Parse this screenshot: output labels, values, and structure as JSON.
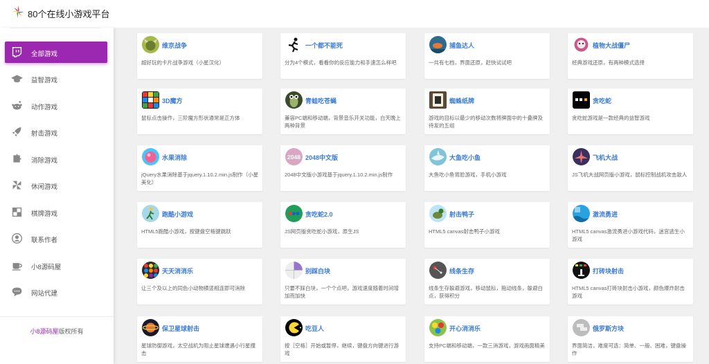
{
  "site": {
    "title": "80个在线小游戏平台"
  },
  "sidebar": {
    "items": [
      {
        "label": "全部游戏",
        "icon": "twitch-icon",
        "active": true
      },
      {
        "label": "益智游戏",
        "icon": "graduation-cap-icon"
      },
      {
        "label": "动作游戏",
        "icon": "reddit-alien-icon"
      },
      {
        "label": "射击游戏",
        "icon": "rocket-icon"
      },
      {
        "label": "消除游戏",
        "icon": "puzzle-icon"
      },
      {
        "label": "休闲游戏",
        "icon": "pinwheel-icon"
      },
      {
        "label": "棋牌游戏",
        "icon": "board-icon"
      },
      {
        "label": "联系作者",
        "icon": "user-icon"
      },
      {
        "label": "小8源码屋",
        "icon": "coffee-icon"
      },
      {
        "label": "网站代建",
        "icon": "chat-icon"
      }
    ],
    "footer": {
      "brand": "小8源码屋",
      "suffix": "版权所有"
    }
  },
  "games": [
    {
      "title": "维京战争",
      "desc": "超好玩的卡片战争游戏（小星汉化）",
      "icon": "viking-icon"
    },
    {
      "title": "一个都不能死",
      "desc": "分为4个模式，看看你的反应能力和手速怎么样吧",
      "icon": "runner-icon"
    },
    {
      "title": "捕鱼达人",
      "desc": "一共有七档，界面还原，赶快试试吧",
      "icon": "fishing-icon"
    },
    {
      "title": "植物大战僵尸",
      "desc": "经典游戏还原，有两种模式选择",
      "icon": "zombie-icon"
    },
    {
      "title": "3D魔方",
      "desc": "鼠标点击操作，三阶魔方形状通常是正方体",
      "icon": "rubiks-cube-icon"
    },
    {
      "title": "青蛙吃苍蝇",
      "desc": "兼容PC端和移动端，背景音乐开关功能，白天晚上两种背景",
      "icon": "frog-icon"
    },
    {
      "title": "蜘蛛纸牌",
      "desc": "游戏的目标以最少的移动次数将牌面中的十叠牌及待发的五组",
      "icon": "cards-icon"
    },
    {
      "title": "贪吃蛇",
      "desc": "贪吃蛇游戏是一款经典的益智游戏",
      "icon": "snake-icon"
    },
    {
      "title": "水果消除",
      "desc": "jQuery水果消除基于jquery.1.10.2.min.js制作（小星美化）",
      "icon": "fruit-icon"
    },
    {
      "title": "2048中文版",
      "desc": "2048中文版小游戏基于jquery.1.10.2.min.js制作",
      "icon": "2048-icon",
      "badge": "2048"
    },
    {
      "title": "大鱼吃小鱼",
      "desc": "大鱼吃小鱼胃脸游戏，手机小游戏",
      "icon": "shark-icon"
    },
    {
      "title": "飞机大战",
      "desc": "JS飞机大战网页版小游戏，鼠标控制战机攻击敌人",
      "icon": "plane-icon"
    },
    {
      "title": "跑酷小游戏",
      "desc": "HTML5跑酷小游戏，按键盘空格键跳跃",
      "icon": "parkour-icon"
    },
    {
      "title": "贪吃蛇2.0",
      "desc": "JS网页版贪吃蛇小游戏，原生JS",
      "icon": "snake2-icon"
    },
    {
      "title": "射击鸭子",
      "desc": "HTML5 canvas射击鸭子小游戏",
      "icon": "duck-icon"
    },
    {
      "title": "激流勇进",
      "desc": "HTML5 canvas激流勇进小游戏代码，迷宫逃生小游戏",
      "icon": "rapids-icon"
    },
    {
      "title": "天天消消乐",
      "desc": "让三个及以上的同色小动物横竖相连即可消除",
      "icon": "match3-icon"
    },
    {
      "title": "别踩白块",
      "desc": "只要不踩白块，一个个点吧，游戏速度随着时间增加而加快",
      "icon": "piano-tiles-icon"
    },
    {
      "title": "线条生存",
      "desc": "线条生存躲避游戏，移动鼠标，拖动线条，躲避白点，获得积分",
      "icon": "line-survive-icon"
    },
    {
      "title": "打砖块射击",
      "desc": "HTML5 canvas打砖块射击小游戏，颜色爆炸射击游戏",
      "icon": "brick-icon"
    },
    {
      "title": "保卫星球射击",
      "desc": "星球防御游戏，太空战机为阻止星球遭遇小行星撞击",
      "icon": "planet-icon"
    },
    {
      "title": "吃豆人",
      "desc": "按［空格］开始或暂停，继续，键盘方向键进行游戏",
      "icon": "pacman-icon"
    },
    {
      "title": "开心消消乐",
      "desc": "支持PC端和移动端，一款三消游戏，游戏画面精美",
      "icon": "happy-match-icon"
    },
    {
      "title": "俄罗斯方块",
      "desc": "界面简洁，难度可选：简单、一般、困难，键盘操作",
      "icon": "tetris-icon"
    }
  ]
}
